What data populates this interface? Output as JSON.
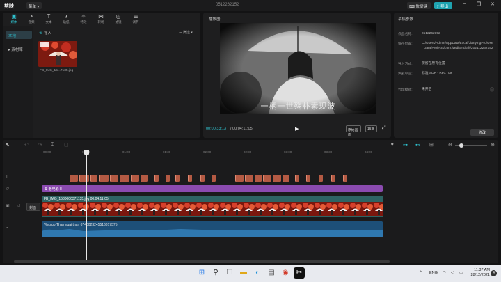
{
  "app": {
    "logo": "剪映",
    "menu_label": "菜单 ▾",
    "window_title": "0512262152",
    "shortcut_label": "⌨ 快捷键",
    "export_label": "⇪ 导出"
  },
  "media": {
    "tabs": [
      {
        "label": "媒体",
        "icon": "media-icon",
        "glyph": "▣"
      },
      {
        "label": "音频",
        "icon": "audio-icon",
        "glyph": "◔"
      },
      {
        "label": "文本",
        "icon": "text-icon",
        "glyph": "T"
      },
      {
        "label": "贴纸",
        "icon": "sticker-icon",
        "glyph": "◕"
      },
      {
        "label": "特效",
        "icon": "effects-icon",
        "glyph": "✧"
      },
      {
        "label": "转场",
        "icon": "transition-icon",
        "glyph": "⋈"
      },
      {
        "label": "滤镜",
        "icon": "filter-icon",
        "glyph": "◎"
      },
      {
        "label": "调节",
        "icon": "adjust-icon",
        "glyph": "⚌"
      }
    ],
    "sidebar": [
      {
        "label": "本地"
      },
      {
        "label": "▸ 素材库"
      }
    ],
    "import_label": "导入",
    "sort_label": "☰ 筛选 ▾",
    "thumb_label": "FB_IMG_15...7135.jpg"
  },
  "player": {
    "title": "播放器",
    "timecode": "00:00:33:13",
    "duration": "/ 00:04:11:05",
    "orig_label": "原始画面",
    "ratio_label": "16:9",
    "subtitle": "一柄一世殇朴素现波"
  },
  "params": {
    "title": "草稿参数",
    "rows": [
      {
        "key": "作品名称:",
        "value": "0512262152"
      },
      {
        "key": "保存位置:",
        "value": "C:/Users/Admin/AppData/Local/JianyingPro/User Data/Projects/com.lveditor.draft/202112262152"
      },
      {
        "key": "导入方式:",
        "value": "保留在原有位置"
      },
      {
        "key": "色彩空间:",
        "value": "标准 SDR - Rec.709"
      },
      {
        "key": "代理模式:",
        "value": "未开启"
      }
    ],
    "modify_label": "修改"
  },
  "timeline": {
    "ruler": [
      "00:00",
      "00:03",
      "01:00",
      "01:30",
      "02:00",
      "02:30",
      "03:00",
      "03:30",
      "04:00"
    ],
    "effect_label": "✪ 老电影 II",
    "video_label": "FB_IMG_1580000371135.jpg   00:04:11:05",
    "cover_label": "封面",
    "audio_label": "Vietsub Than ngai than 6748023245516817575"
  },
  "taskbar": {
    "lang": "ENG",
    "time": "11:37 AM",
    "date": "28/12/2021",
    "badge": "4"
  }
}
